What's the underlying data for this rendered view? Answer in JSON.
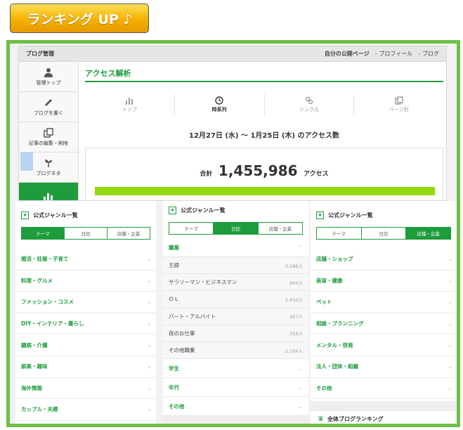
{
  "ranking_button": "ランキング UP ♪",
  "admin": {
    "title": "ブログ管理",
    "links": [
      "自分の公開ページ",
      "プロフィール",
      "ブログ"
    ],
    "sidebar": [
      "管理トップ",
      "ブログを書く",
      "記事の編集・削除",
      "ブログネタ"
    ],
    "page_title": "アクセス解析",
    "tabs": [
      "トップ",
      "時系列",
      "リンク元",
      "ページ別"
    ],
    "range": "12月27日 (水) 〜 1月25日 (木) のアクセス数",
    "total_label": "合計",
    "total_value": "1,455,986",
    "total_unit": "アクセス"
  },
  "genre_panel_1": {
    "title": "公式ジャンル一覧",
    "tabs": [
      "テーマ",
      "日記",
      "店舗・企業"
    ],
    "items": [
      "婚活・妊娠・子育て",
      "料理・グルメ",
      "ファッション・コスメ",
      "DIY・インテリア・暮らし",
      "闘病・介護",
      "娯楽・趣味",
      "海外情報",
      "カップル・夫婦"
    ]
  },
  "genre_panel_2": {
    "title": "公式ジャンル一覧",
    "tabs": [
      "テーマ",
      "日記",
      "店舗・企業"
    ],
    "category": "職業",
    "subitems": [
      {
        "name": "主婦",
        "count": "3,186人"
      },
      {
        "name": "サラリーマン・ビジネスマン",
        "count": "604人"
      },
      {
        "name": "ＯＬ",
        "count": "1,410人"
      },
      {
        "name": "パート・アルバイト",
        "count": "407人"
      },
      {
        "name": "夜のお仕事",
        "count": "319人"
      },
      {
        "name": "その他職業",
        "count": "2,154人"
      }
    ],
    "items": [
      "学生",
      "年代",
      "その他"
    ]
  },
  "genre_panel_3": {
    "title": "公式ジャンル一覧",
    "tabs": [
      "テーマ",
      "日記",
      "店舗・企業"
    ],
    "items": [
      "店舗・ショップ",
      "美容・健康",
      "ペット",
      "相談・プランニング",
      "メンタル・啓発",
      "法人・団体・組織",
      "その他"
    ],
    "overall": "全体ブログランキング"
  },
  "colors": {
    "accent": "#1e9c3c",
    "frame": "#6fbf45",
    "bar": "#95d80e",
    "button": "#f4b000"
  }
}
